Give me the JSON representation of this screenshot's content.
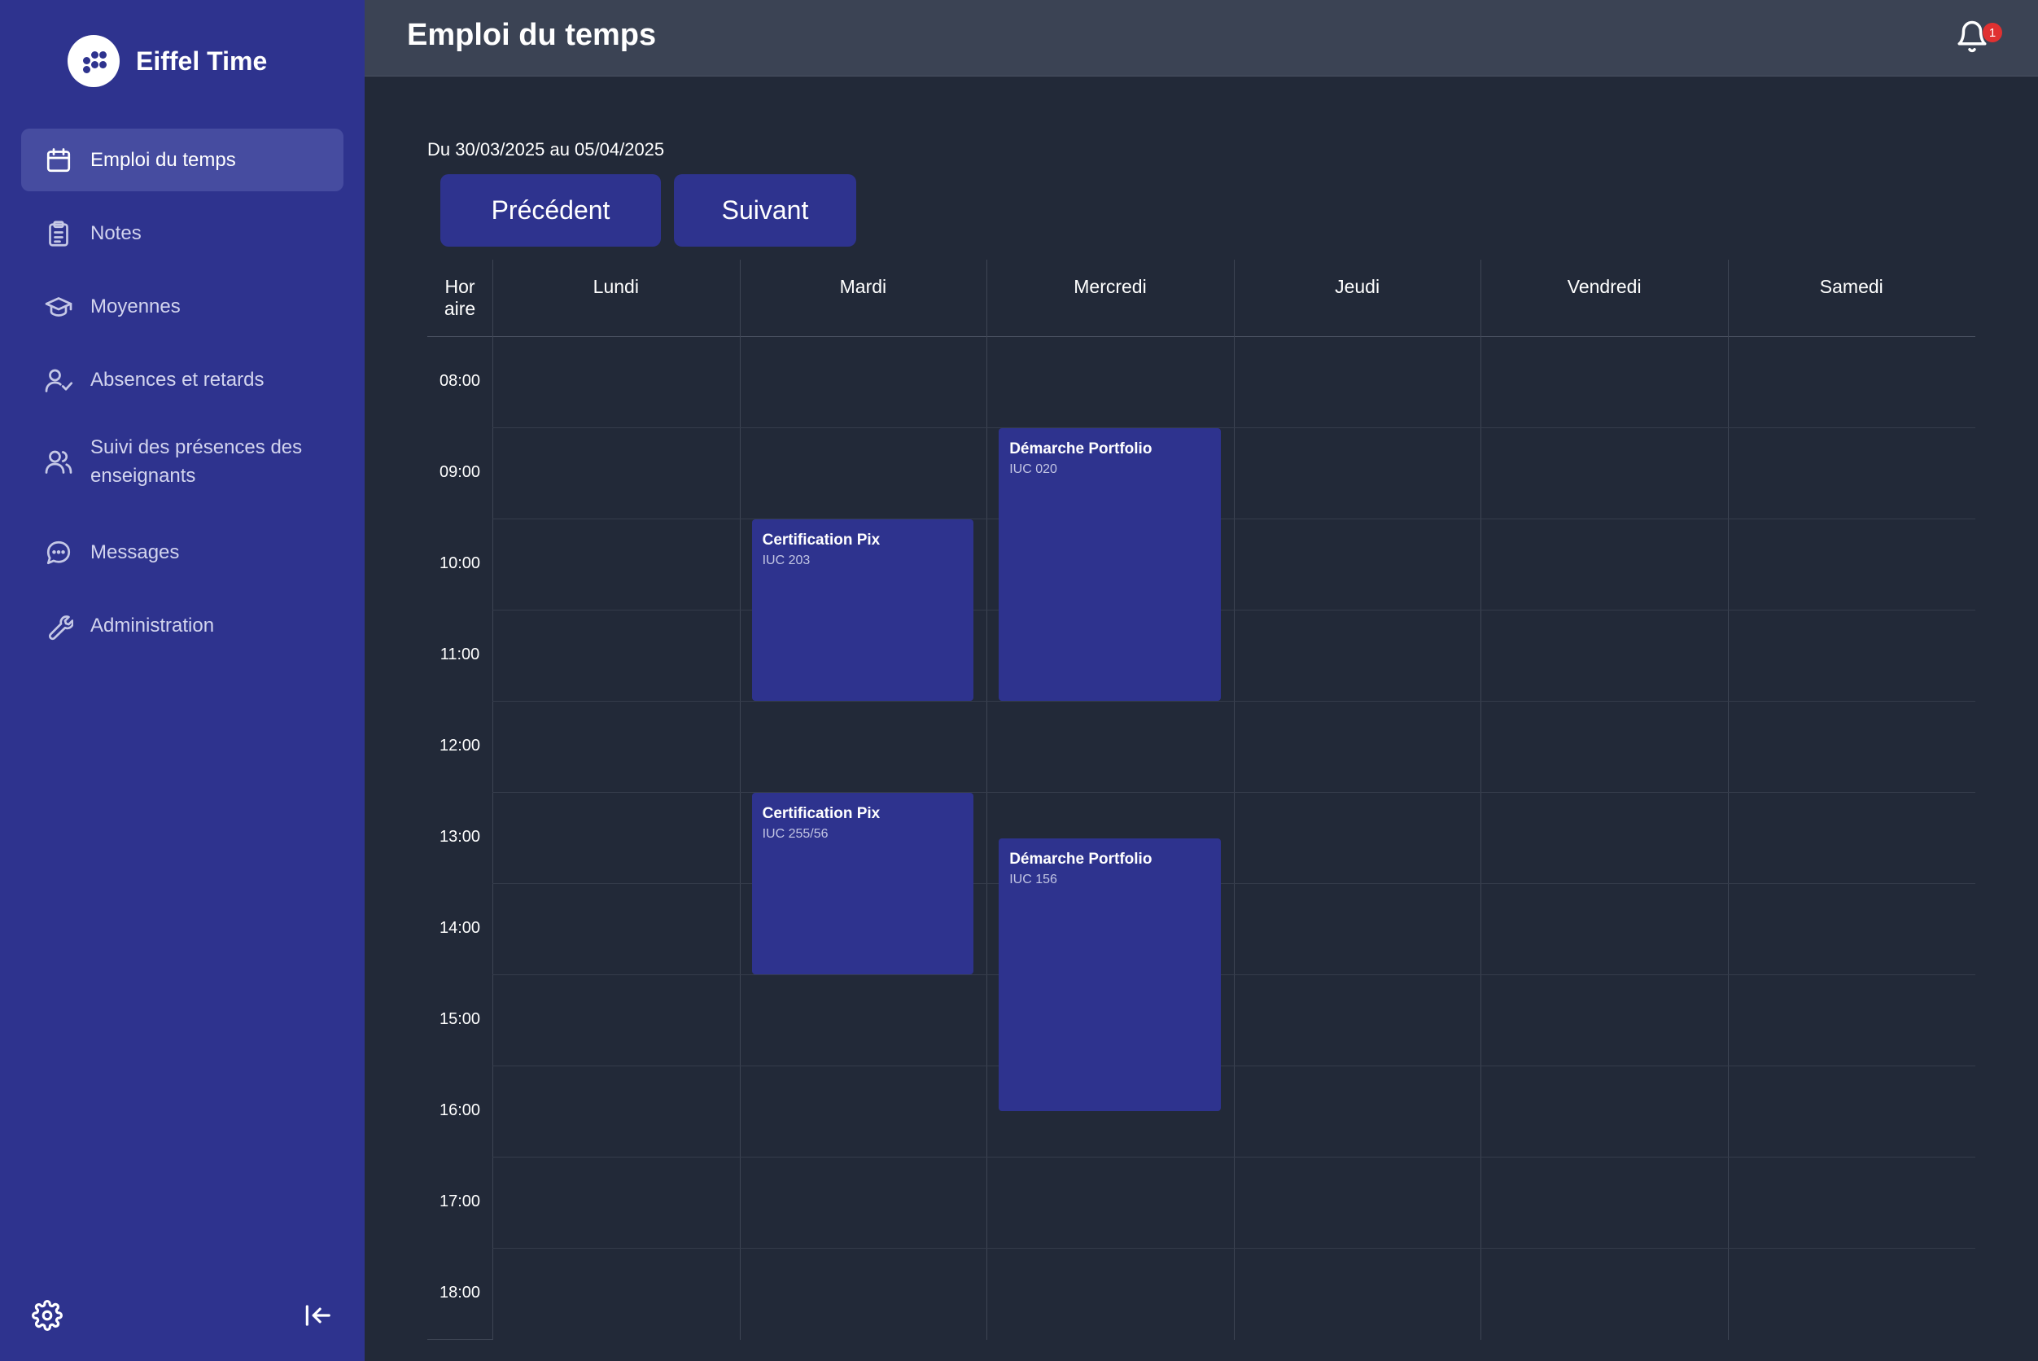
{
  "app": {
    "name": "Eiffel Time"
  },
  "sidebar": {
    "items": [
      {
        "label": "Emploi du temps",
        "icon": "calendar-icon",
        "active": true
      },
      {
        "label": "Notes",
        "icon": "clipboard-icon",
        "active": false
      },
      {
        "label": "Moyennes",
        "icon": "graduation-cap-icon",
        "active": false
      },
      {
        "label": "Absences et retards",
        "icon": "user-check-icon",
        "active": false
      },
      {
        "label": "Suivi des présences des enseignants",
        "icon": "users-icon",
        "active": false
      },
      {
        "label": "Messages",
        "icon": "chat-bubble-icon",
        "active": false
      },
      {
        "label": "Administration",
        "icon": "wrench-icon",
        "active": false
      }
    ],
    "footer": {
      "settings_icon": "gear-icon",
      "collapse_icon": "collapse-left-icon"
    }
  },
  "header": {
    "title": "Emploi du temps",
    "notifications": {
      "icon": "bell-icon",
      "count": "1"
    }
  },
  "schedule": {
    "range": "Du 30/03/2025 au 05/04/2025",
    "prev_label": "Précédent",
    "next_label": "Suivant",
    "hour_column_label": "Hor aire",
    "days": [
      "Lundi",
      "Mardi",
      "Mercredi",
      "Jeudi",
      "Vendredi",
      "Samedi"
    ],
    "hours": [
      "08:00",
      "09:00",
      "10:00",
      "11:00",
      "12:00",
      "13:00",
      "14:00",
      "15:00",
      "16:00",
      "17:00",
      "18:00"
    ],
    "events": [
      {
        "title": "Certification Pix",
        "room": "IUC 203",
        "day": "Mardi",
        "start": "10:00",
        "end": "12:00"
      },
      {
        "title": "Démarche Portfolio",
        "room": "IUC 020",
        "day": "Mercredi",
        "start": "09:00",
        "end": "12:00"
      },
      {
        "title": "Certification Pix",
        "room": "IUC 255/56",
        "day": "Mardi",
        "start": "13:00",
        "end": "15:00"
      },
      {
        "title": "Démarche Portfolio",
        "room": "IUC 156",
        "day": "Mercredi",
        "start": "13:30",
        "end": "16:30"
      }
    ]
  },
  "colors": {
    "sidebar": "#2e338e",
    "accent": "#2e338e",
    "background": "#222938",
    "topbar": "#3b4354",
    "badge": "#e03131"
  }
}
